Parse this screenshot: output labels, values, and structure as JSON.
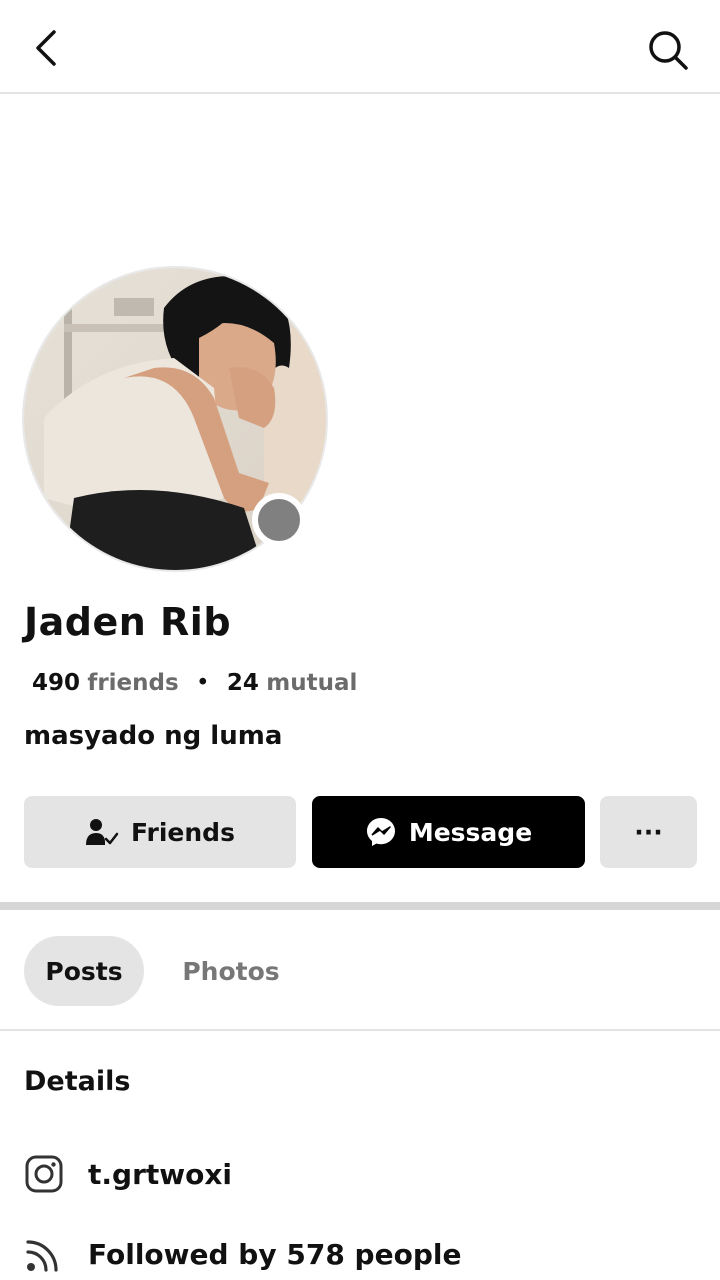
{
  "header": {
    "back_icon": "chevron-left-icon",
    "search_icon": "search-icon"
  },
  "profile": {
    "name": "Jaden Rib",
    "friends_count": "490",
    "friends_label": "friends",
    "separator": "•",
    "mutual_count": "24",
    "mutual_label": "mutual",
    "bio": "masyado ng luma",
    "status_color": "#808080"
  },
  "actions": {
    "friends_label": "Friends",
    "message_label": "Message",
    "more_label": "···"
  },
  "tabs": [
    {
      "label": "Posts",
      "selected": true
    },
    {
      "label": "Photos",
      "selected": false
    }
  ],
  "details": {
    "title": "Details",
    "items": [
      {
        "icon": "instagram-icon",
        "text": "t.grtwoxi"
      },
      {
        "icon": "rss-feed-icon",
        "text": "Followed by 578 people"
      }
    ]
  }
}
